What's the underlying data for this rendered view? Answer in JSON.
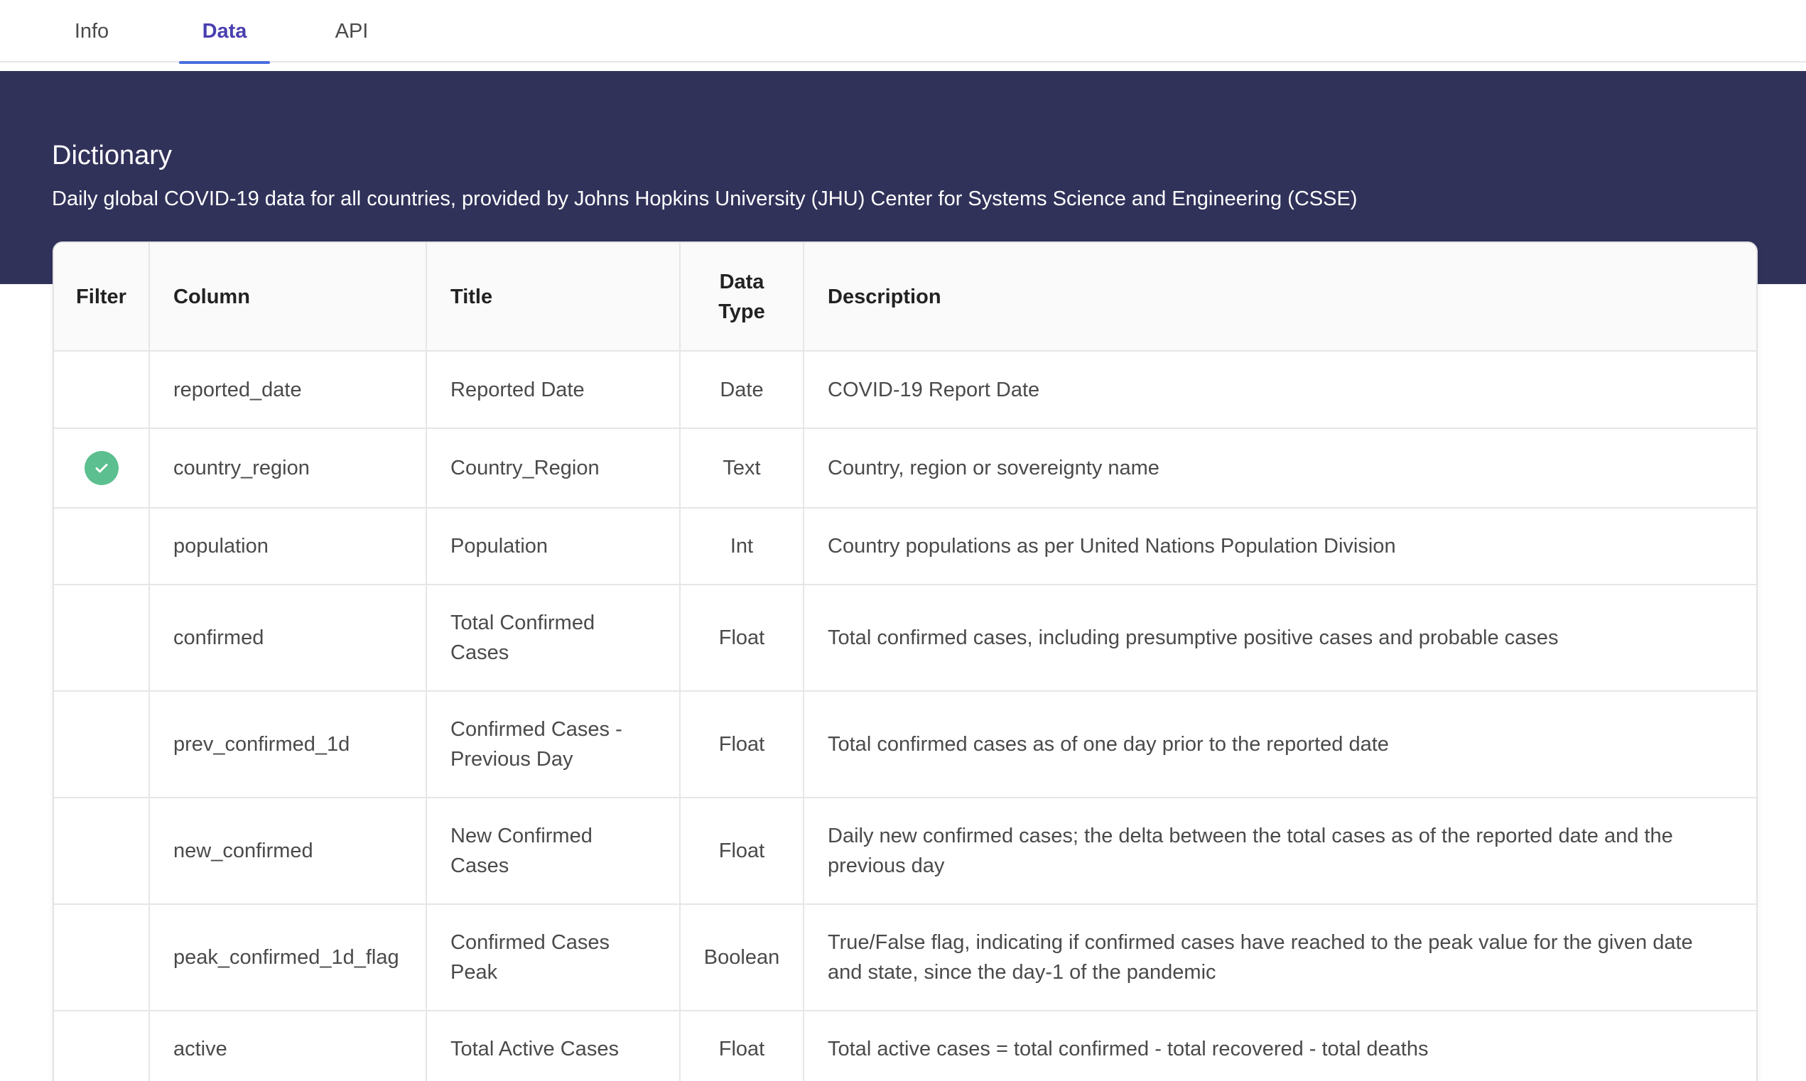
{
  "tabs": [
    {
      "label": "Info",
      "active": false
    },
    {
      "label": "Data",
      "active": true
    },
    {
      "label": "API",
      "active": false
    }
  ],
  "dictionary": {
    "title": "Dictionary",
    "subtitle": "Daily global COVID-19 data for all countries, provided by Johns Hopkins University (JHU) Center for Systems Science and Engineering (CSSE)"
  },
  "table": {
    "headers": {
      "filter": "Filter",
      "column": "Column",
      "title": "Title",
      "data_type": "Data Type",
      "description": "Description"
    },
    "rows": [
      {
        "filter": false,
        "column": "reported_date",
        "title": "Reported Date",
        "data_type": "Date",
        "description": "COVID-19 Report Date"
      },
      {
        "filter": true,
        "column": "country_region",
        "title": "Country_Region",
        "data_type": "Text",
        "description": "Country, region or sovereignty name"
      },
      {
        "filter": false,
        "column": "population",
        "title": "Population",
        "data_type": "Int",
        "description": "Country populations as per United Nations Population Division"
      },
      {
        "filter": false,
        "column": "confirmed",
        "title": "Total Confirmed Cases",
        "data_type": "Float",
        "description": "Total confirmed cases, including presumptive positive cases and probable cases"
      },
      {
        "filter": false,
        "column": "prev_confirmed_1d",
        "title": "Confirmed Cases - Previous Day",
        "data_type": "Float",
        "description": "Total confirmed cases as of one day prior to the reported date"
      },
      {
        "filter": false,
        "column": "new_confirmed",
        "title": "New Confirmed Cases",
        "data_type": "Float",
        "description": "Daily new confirmed cases; the delta between the total cases as of the reported date and the previous day"
      },
      {
        "filter": false,
        "column": "peak_confirmed_1d_flag",
        "title": "Confirmed Cases Peak",
        "data_type": "Boolean",
        "description": "True/False flag, indicating if confirmed cases have reached to the peak value for the given date and state, since the day-1 of the pandemic"
      },
      {
        "filter": false,
        "column": "active",
        "title": "Total Active Cases",
        "data_type": "Float",
        "description": "Total active cases = total confirmed - total recovered - total deaths"
      }
    ]
  },
  "icons": {
    "filter_active": "check-circle-icon"
  },
  "colors": {
    "banner": "#30325a",
    "active_tab_text": "#4a3fb0",
    "active_tab_underline": "#4a6ee0",
    "check": "#5cbf8f"
  }
}
